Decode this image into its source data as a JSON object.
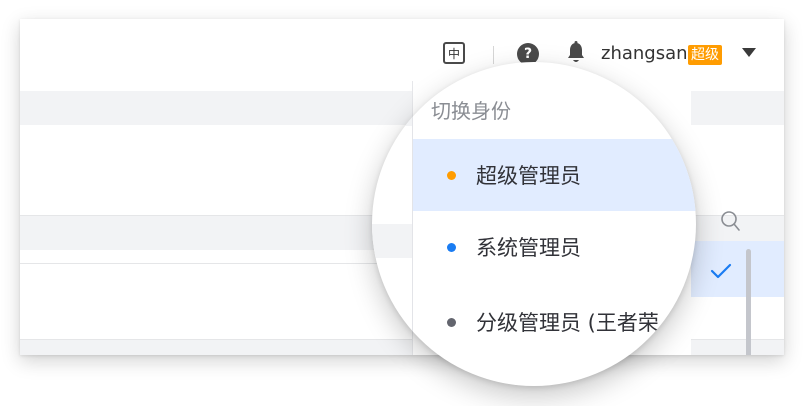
{
  "topbar": {
    "language_label": "中",
    "help_label": "?",
    "username": "zhangsan",
    "role_badge": "超级",
    "badge_color": "#ff9c01"
  },
  "identity_switcher": {
    "title": "切换身份",
    "options": [
      {
        "label": "超级管理员",
        "dot_color": "#ff9c01",
        "active": true
      },
      {
        "label": "系统管理员",
        "dot_color": "#1a7cf2",
        "active": false
      },
      {
        "label": "分级管理员 (王者荣",
        "dot_color": "#63656e",
        "active": false
      }
    ]
  },
  "icons": {
    "language": "language-switch-icon",
    "help": "help-icon",
    "notification": "bell-icon",
    "dropdown": "caret-down-icon",
    "search": "search-icon",
    "selected": "check-icon"
  }
}
